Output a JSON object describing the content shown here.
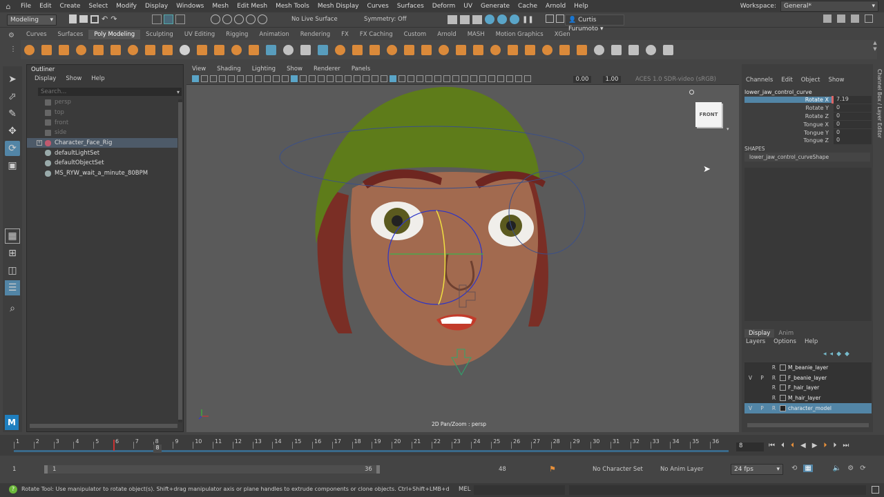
{
  "menubar": {
    "items": [
      "File",
      "Edit",
      "Create",
      "Select",
      "Modify",
      "Display",
      "Windows",
      "Mesh",
      "Edit Mesh",
      "Mesh Tools",
      "Mesh Display",
      "Curves",
      "Surfaces",
      "Deform",
      "UV",
      "Generate",
      "Cache",
      "Arnold",
      "Help"
    ],
    "workspace_label": "Workspace:",
    "workspace_value": "General*"
  },
  "statusline": {
    "mode": "Modeling",
    "live_surface": "No Live Surface",
    "symmetry": "Symmetry: Off",
    "user": "Curtis Furumoto"
  },
  "shelf": {
    "tabs": [
      "Curves",
      "Surfaces",
      "Poly Modeling",
      "Sculpting",
      "UV Editing",
      "Rigging",
      "Animation",
      "Rendering",
      "FX",
      "FX Caching",
      "Custom",
      "Arnold",
      "MASH",
      "Motion Graphics",
      "XGen"
    ],
    "active_tab": "Poly Modeling"
  },
  "outliner": {
    "title": "Outliner",
    "menu": [
      "Display",
      "Show",
      "Help"
    ],
    "search_placeholder": "Search...",
    "items": [
      {
        "label": "persp",
        "dim": true
      },
      {
        "label": "top",
        "dim": true
      },
      {
        "label": "front",
        "dim": true
      },
      {
        "label": "side",
        "dim": true
      },
      {
        "label": "Character_Face_Rig",
        "dim": false,
        "selected": true
      },
      {
        "label": "defaultLightSet",
        "dim": false
      },
      {
        "label": "defaultObjectSet",
        "dim": false
      },
      {
        "label": "MS_RYW_wait_a_minute_80BPM",
        "dim": false
      }
    ]
  },
  "viewport": {
    "menu": [
      "View",
      "Shading",
      "Lighting",
      "Show",
      "Renderer",
      "Panels"
    ],
    "field1": "0.00",
    "field2": "1.00",
    "colorspace": "ACES 1.0 SDR-video (sRGB)",
    "viewcube": "FRONT",
    "hud": "2D Pan/Zoom : persp"
  },
  "channelbox": {
    "menu": [
      "Channels",
      "Edit",
      "Object",
      "Show"
    ],
    "object": "lower_jaw_control_curve",
    "channels": [
      {
        "name": "Rotate X",
        "value": "7.19",
        "selected": true
      },
      {
        "name": "Rotate Y",
        "value": "0"
      },
      {
        "name": "Rotate Z",
        "value": "0"
      },
      {
        "name": "Tongue X",
        "value": "0"
      },
      {
        "name": "Tongue Y",
        "value": "0"
      },
      {
        "name": "Tongue Z",
        "value": "0"
      }
    ],
    "shapes_label": "SHAPES",
    "shape": "lower_jaw_control_curveShape",
    "side_tab": "Channel Box / Layer Editor"
  },
  "layers": {
    "tabs": [
      "Display",
      "Anim"
    ],
    "menu": [
      "Layers",
      "Options",
      "Help"
    ],
    "items": [
      {
        "v": "",
        "p": "",
        "r": "R",
        "name": "M_beanie_layer"
      },
      {
        "v": "V",
        "p": "P",
        "r": "R",
        "name": "F_beanie_layer"
      },
      {
        "v": "",
        "p": "",
        "r": "R",
        "name": "F_hair_layer"
      },
      {
        "v": "",
        "p": "",
        "r": "R",
        "name": "M_hair_layer"
      },
      {
        "v": "V",
        "p": "P",
        "r": "R",
        "name": "character_model",
        "selected": true
      }
    ]
  },
  "timeslider": {
    "ticks": [
      "1",
      "2",
      "3",
      "4",
      "5",
      "6",
      "7",
      "8",
      "9",
      "10",
      "11",
      "12",
      "13",
      "14",
      "15",
      "16",
      "17",
      "18",
      "19",
      "20",
      "21",
      "22",
      "23",
      "24",
      "25",
      "26",
      "27",
      "28",
      "29",
      "30",
      "31",
      "32",
      "33",
      "34",
      "35",
      "36"
    ],
    "current": "8",
    "current_field": "8"
  },
  "range": {
    "start": "1",
    "start2": "1",
    "end": "36",
    "end2": "48",
    "character_set": "No Character Set",
    "anim_layer": "No Anim Layer",
    "fps": "24 fps"
  },
  "helpline": {
    "text": "Rotate Tool: Use manipulator to rotate object(s). Shift+drag manipulator axis or plane handles to extrude components or clone objects. Ctrl+Shift+LMB+drag to constrain rc",
    "mel": "MEL"
  },
  "colors": {
    "accent": "#5285a6",
    "shelf_orange": "#e8903a"
  }
}
